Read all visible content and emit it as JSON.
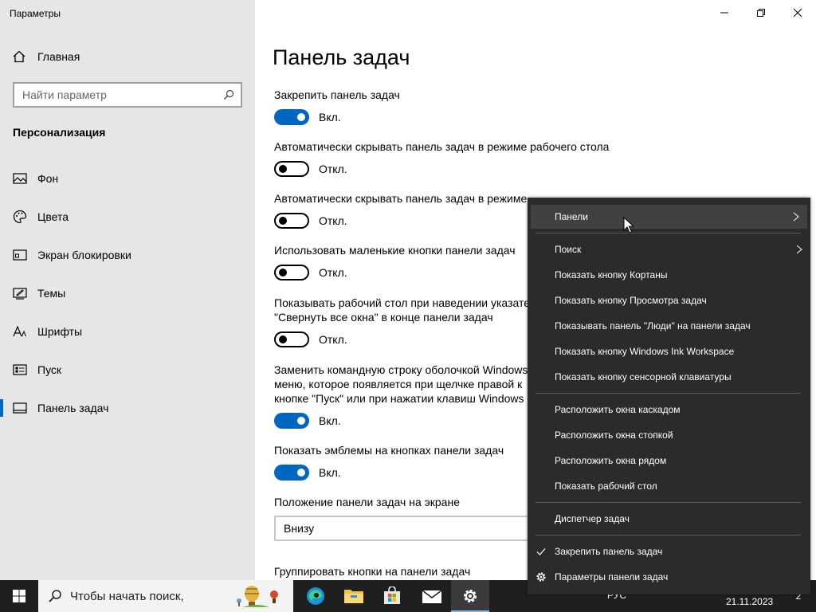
{
  "window": {
    "title": "Параметры",
    "controls": {
      "minimize": "minimize",
      "maximize": "restore",
      "close": "close"
    }
  },
  "sidebar": {
    "home_label": "Главная",
    "search_placeholder": "Найти параметр",
    "section_title": "Персонализация",
    "items": [
      {
        "label": "Фон",
        "icon": "image-icon"
      },
      {
        "label": "Цвета",
        "icon": "palette-icon"
      },
      {
        "label": "Экран блокировки",
        "icon": "lock-screen-icon"
      },
      {
        "label": "Темы",
        "icon": "themes-icon"
      },
      {
        "label": "Шрифты",
        "icon": "font-icon"
      },
      {
        "label": "Пуск",
        "icon": "start-icon"
      },
      {
        "label": "Панель задач",
        "icon": "taskbar-icon",
        "active": true
      }
    ]
  },
  "main": {
    "title": "Панель задач",
    "settings": [
      {
        "label": "Закрепить панель задач",
        "state": "on",
        "state_label": "Вкл."
      },
      {
        "label": "Автоматически скрывать панель задач в режиме рабочего стола",
        "state": "off",
        "state_label": "Откл."
      },
      {
        "label": "Автоматически скрывать панель задач в режиме",
        "state": "off",
        "state_label": "Откл."
      },
      {
        "label": "Использовать маленькие кнопки панели задач",
        "state": "off",
        "state_label": "Откл."
      },
      {
        "label": "Показывать рабочий стол при наведении указате",
        "label2": "\"Свернуть все окна\" в конце панели задач",
        "state": "off",
        "state_label": "Откл."
      },
      {
        "label": "Заменить командную строку оболочкой Windows",
        "label2": "меню, которое появляется при щелчке правой к",
        "label3": "кнопке \"Пуск\" или при нажатии клавиш Windows",
        "state": "on",
        "state_label": "Вкл."
      },
      {
        "label": "Показать эмблемы на кнопках панели задач",
        "state": "on",
        "state_label": "Вкл."
      }
    ],
    "position_label": "Положение панели задач на экране",
    "position_value": "Внизу",
    "group_label": "Группировать кнопки на панели задач"
  },
  "context_menu": {
    "items": [
      {
        "label": "Панели",
        "submenu": true
      },
      {
        "label": "Поиск",
        "submenu": true
      },
      {
        "label": "Показать кнопку Кортаны"
      },
      {
        "label": "Показать кнопку Просмотра задач"
      },
      {
        "label": "Показывать панель \"Люди\" на панели задач"
      },
      {
        "label": "Показать кнопку Windows Ink Workspace"
      },
      {
        "label": "Показать кнопку сенсорной клавиатуры"
      },
      {
        "label": "Расположить окна каскадом"
      },
      {
        "label": "Расположить окна стопкой"
      },
      {
        "label": "Расположить окна рядом"
      },
      {
        "label": "Показать рабочий стол"
      },
      {
        "label": "Диспетчер задач"
      },
      {
        "label": "Закрепить панель задач",
        "checked": true
      },
      {
        "label": "Параметры панели задач",
        "icon": "gear-icon"
      }
    ]
  },
  "taskbar": {
    "search_placeholder": "Чтобы начать поиск,",
    "apps": [
      "edge-icon",
      "file-explorer-icon",
      "store-icon",
      "mail-icon",
      "settings-icon"
    ],
    "tray": {
      "lang": "РУС",
      "date": "21.11.2023",
      "notifications": "2"
    }
  }
}
